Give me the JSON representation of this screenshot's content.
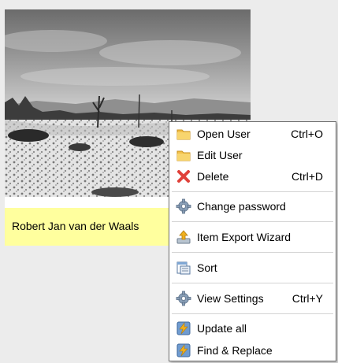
{
  "user_card": {
    "name": "Robert Jan van der Waals",
    "photo_icon": "snow-landscape-photo"
  },
  "context_menu": {
    "items": [
      {
        "label": "Open User",
        "shortcut": "Ctrl+O",
        "icon": "folder-icon"
      },
      {
        "label": "Edit User",
        "shortcut": "",
        "icon": "folder-icon"
      },
      {
        "label": "Delete",
        "shortcut": "Ctrl+D",
        "icon": "delete-x-icon"
      },
      {
        "label": "Change password",
        "shortcut": "",
        "icon": "gear-icon"
      },
      {
        "label": "Item Export Wizard",
        "shortcut": "",
        "icon": "export-tray-icon"
      },
      {
        "label": "Sort",
        "shortcut": "",
        "icon": "sort-icon"
      },
      {
        "label": "View Settings",
        "shortcut": "Ctrl+Y",
        "icon": "gear-icon"
      },
      {
        "label": "Update all",
        "shortcut": "",
        "icon": "lightning-icon"
      },
      {
        "label": "Find & Replace",
        "shortcut": "",
        "icon": "lightning-icon"
      }
    ]
  },
  "colors": {
    "name_bar_background": "#ffff9e",
    "menu_border": "#6e6e6e",
    "separator": "#d4d4d4",
    "delete_icon": "#e0413a",
    "folder_icon": "#f3c04a",
    "lightning_icon": "#f0b01e"
  }
}
